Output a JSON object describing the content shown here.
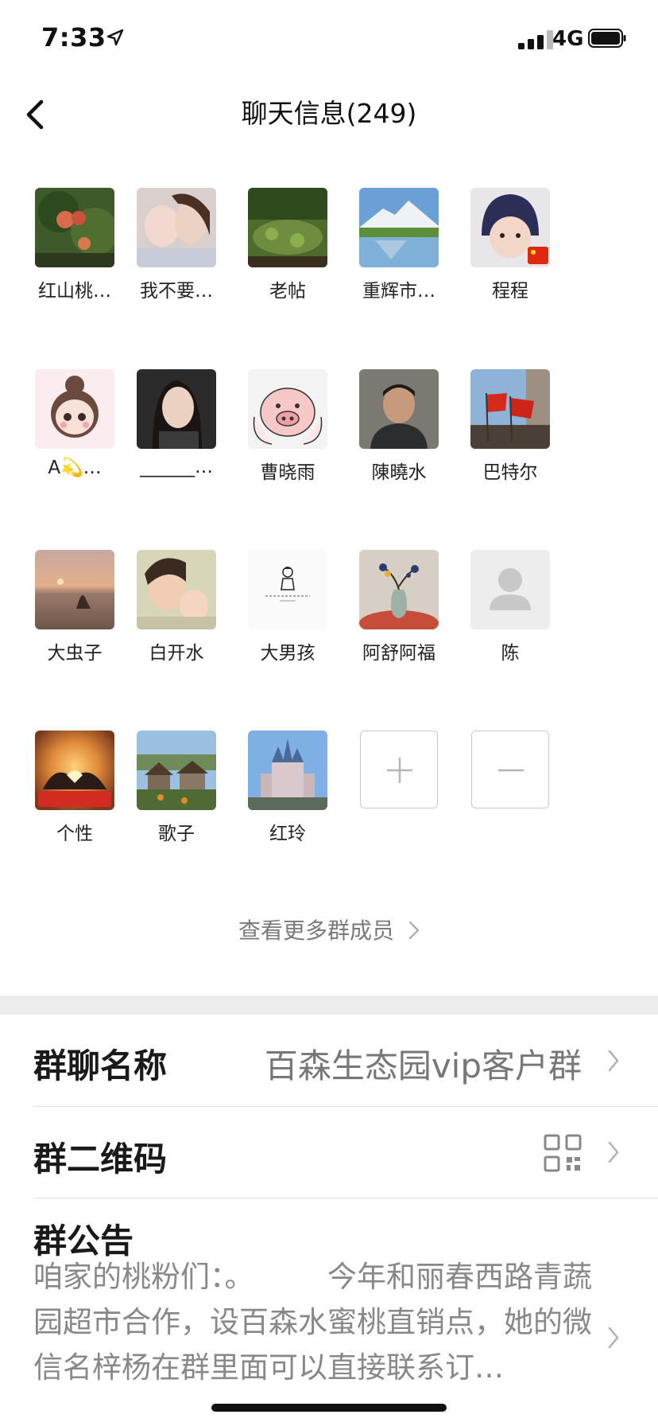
{
  "status_bar": {
    "time": "7:33",
    "network": "4G"
  },
  "nav": {
    "title": "聊天信息(249)"
  },
  "members": [
    {
      "name": "红山桃…",
      "avatar": "peach-tree-photo"
    },
    {
      "name": "我不要…",
      "avatar": "mother-child-photo"
    },
    {
      "name": "老帖",
      "avatar": "pond-photo"
    },
    {
      "name": "重辉市…",
      "avatar": "mountain-lake-photo"
    },
    {
      "name": "程程",
      "avatar": "baby-photo"
    },
    {
      "name": "A💫…",
      "avatar": "cartoon-girl"
    },
    {
      "name": "______…",
      "avatar": "woman-selfie-photo"
    },
    {
      "name": "曹晓雨",
      "avatar": "cartoon-pig"
    },
    {
      "name": "陳曉水",
      "avatar": "man-portrait-photo"
    },
    {
      "name": "巴特尔",
      "avatar": "red-flags-photo"
    },
    {
      "name": "大虫子",
      "avatar": "desert-sunset-photo"
    },
    {
      "name": "白开水",
      "avatar": "mother-child-blur-photo"
    },
    {
      "name": "大男孩",
      "avatar": "sketch-figure"
    },
    {
      "name": "阿舒阿福",
      "avatar": "vase-flowers-photo"
    },
    {
      "name": "陈",
      "avatar": "default-avatar"
    },
    {
      "name": "个性",
      "avatar": "china-heart-hands"
    },
    {
      "name": "歌子",
      "avatar": "village-photo"
    },
    {
      "name": "红玲",
      "avatar": "castle-photo"
    }
  ],
  "actions": {
    "add_icon": "plus-icon",
    "remove_icon": "minus-icon"
  },
  "more_members": "查看更多群成员",
  "group_name": {
    "label": "群聊名称",
    "value": "百森生态园vip客户群"
  },
  "qr": {
    "label": "群二维码",
    "icon": "qr-code-icon"
  },
  "notice": {
    "label": "群公告",
    "text": "咱家的桃粉们：。　　　今年和丽春西路青蔬园超市合作，设百森水蜜桃直销点，她的微信名梓杨在群里面可以直接联系订…"
  },
  "colors": {
    "divider": "#e2e2e2",
    "section_gap": "#ededed",
    "secondary_text": "#777777"
  }
}
